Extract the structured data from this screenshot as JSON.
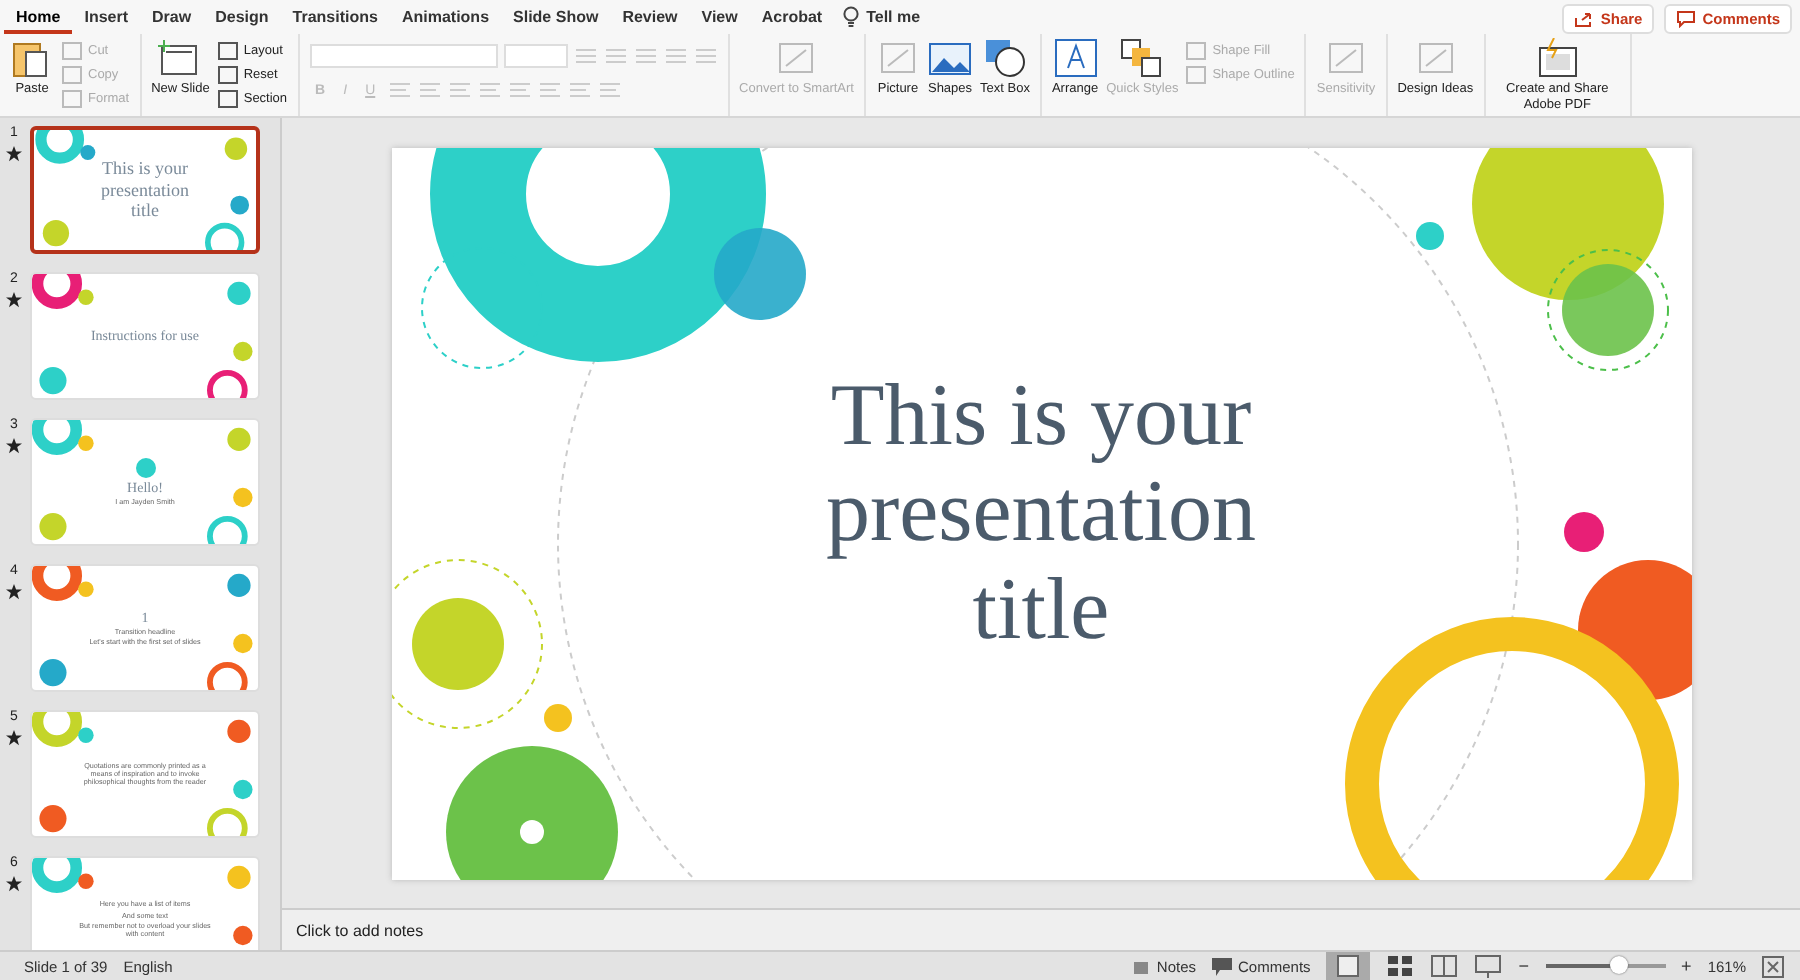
{
  "tabs": [
    {
      "label": "Home",
      "selected": true
    },
    {
      "label": "Insert",
      "selected": false
    },
    {
      "label": "Draw",
      "selected": false
    },
    {
      "label": "Design",
      "selected": false
    },
    {
      "label": "Transitions",
      "selected": false
    },
    {
      "label": "Animations",
      "selected": false
    },
    {
      "label": "Slide Show",
      "selected": false
    },
    {
      "label": "Review",
      "selected": false
    },
    {
      "label": "View",
      "selected": false
    },
    {
      "label": "Acrobat",
      "selected": false
    }
  ],
  "tell_me": "Tell me",
  "share_button": "Share",
  "comments_button": "Comments",
  "ribbon": {
    "groups": [
      {
        "items": [
          {
            "kind": "large",
            "label": "Paste",
            "disabled": false
          },
          {
            "kind": "small",
            "label": "Cut",
            "disabled": true
          },
          {
            "kind": "small",
            "label": "Copy",
            "disabled": true
          },
          {
            "kind": "small",
            "label": "Format",
            "disabled": true
          }
        ]
      },
      {
        "items": [
          {
            "kind": "large",
            "label": "New Slide",
            "disabled": false
          },
          {
            "kind": "small",
            "label": "Layout",
            "disabled": false
          },
          {
            "kind": "small",
            "label": "Reset",
            "disabled": false
          },
          {
            "kind": "small",
            "label": "Section",
            "disabled": false
          }
        ]
      },
      {
        "kind": "font",
        "disabled": true
      },
      {
        "items": [
          {
            "kind": "large",
            "label": "Convert to SmartArt",
            "disabled": true
          }
        ]
      },
      {
        "items": [
          {
            "kind": "large",
            "label": "Picture",
            "disabled": false
          },
          {
            "kind": "large",
            "label": "Shapes",
            "disabled": false
          },
          {
            "kind": "large",
            "label": "Text Box",
            "disabled": false
          }
        ]
      },
      {
        "items": [
          {
            "kind": "large",
            "label": "Arrange",
            "disabled": false
          },
          {
            "kind": "large",
            "label": "Quick Styles",
            "disabled": true
          },
          {
            "kind": "small",
            "label": "Shape Fill",
            "disabled": true
          },
          {
            "kind": "small",
            "label": "Shape Outline",
            "disabled": true
          }
        ]
      },
      {
        "items": [
          {
            "kind": "large",
            "label": "Sensitivity",
            "disabled": true
          }
        ]
      },
      {
        "items": [
          {
            "kind": "large",
            "label": "Design Ideas",
            "disabled": false
          }
        ]
      },
      {
        "items": [
          {
            "kind": "large",
            "label": "Create and Share Adobe PDF",
            "disabled": false
          }
        ]
      }
    ]
  },
  "format_buttons": [
    "B",
    "I",
    "U"
  ],
  "slides": [
    {
      "number": "1",
      "selected": true,
      "title": "This is your presentation title"
    },
    {
      "number": "2",
      "selected": false,
      "title": "Instructions for use"
    },
    {
      "number": "3",
      "selected": false,
      "title": "Hello!",
      "lines": [
        "I am Jayden Smith"
      ]
    },
    {
      "number": "4",
      "selected": false,
      "title": "1",
      "lines": [
        "Transition headline",
        "Let's start with the first set of slides"
      ]
    },
    {
      "number": "5",
      "selected": false,
      "lines": [
        "Quotations are commonly printed as a means of inspiration and to invoke philosophical thoughts from the reader"
      ]
    },
    {
      "number": "6",
      "selected": false,
      "lines": [
        "Here you have a list of items",
        "And some text",
        "But remember not to overload your slides with content"
      ]
    }
  ],
  "main_slide": {
    "title": "This is your presentation title"
  },
  "notes": {
    "placeholder": "Click to add notes"
  },
  "status_bar": {
    "slide_counter": "Slide 1 of 39",
    "language": "English",
    "notes": "Notes",
    "comments": "Comments",
    "zoom_out": "−",
    "zoom_in": "+",
    "zoom": {
      "level": 0.6,
      "reading": "161%"
    }
  }
}
